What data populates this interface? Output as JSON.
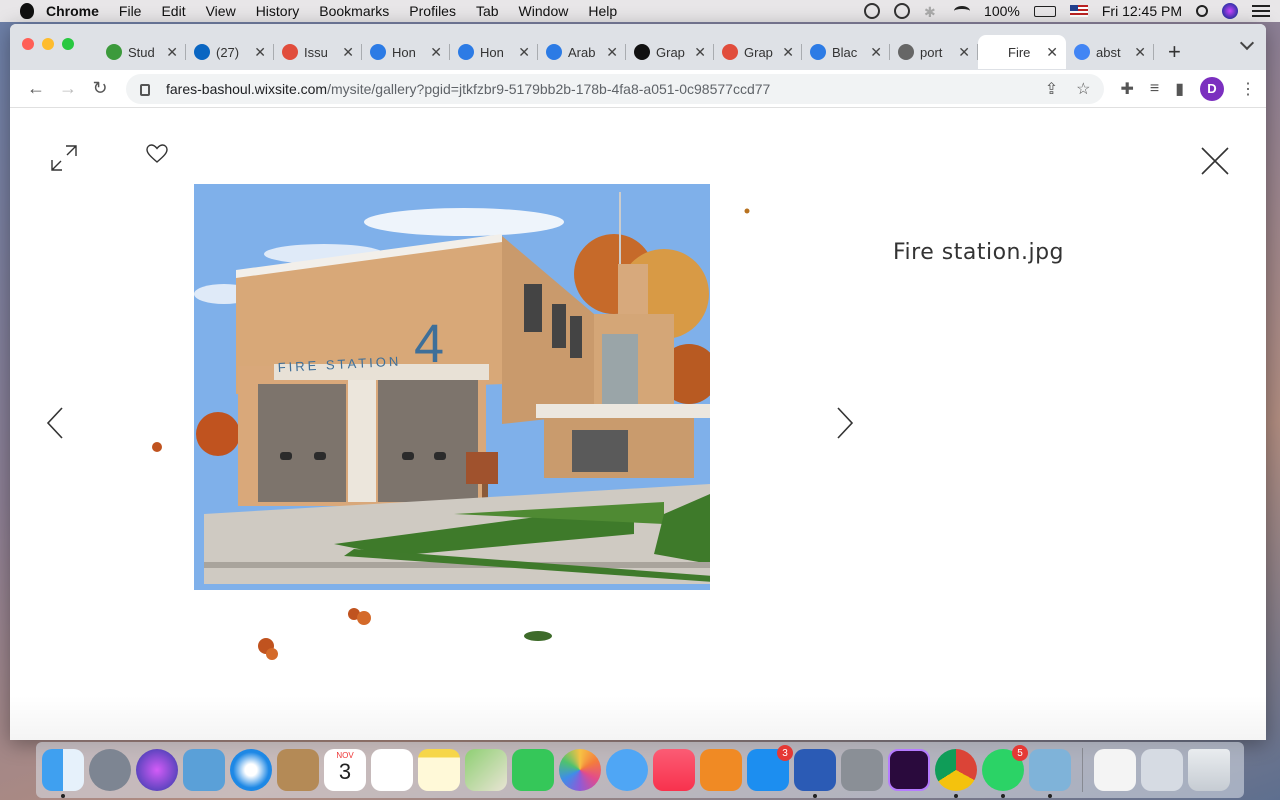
{
  "menubar": {
    "app": "Chrome",
    "items": [
      "File",
      "Edit",
      "View",
      "History",
      "Bookmarks",
      "Profiles",
      "Tab",
      "Window",
      "Help"
    ],
    "battery": "100%",
    "clock": "Fri 12:45 PM"
  },
  "tabs": [
    {
      "label": "Stud",
      "color": "#3c9a3c"
    },
    {
      "label": "(27)",
      "color": "#0a66c2"
    },
    {
      "label": "Issu",
      "color": "#e14d3c"
    },
    {
      "label": "Hon",
      "color": "#2c7be5"
    },
    {
      "label": "Hon",
      "color": "#2c7be5"
    },
    {
      "label": "Arab",
      "color": "#2c7be5"
    },
    {
      "label": "Grap",
      "color": "#111111"
    },
    {
      "label": "Grap",
      "color": "#e14d3c"
    },
    {
      "label": "Blac",
      "color": "#2c7be5"
    },
    {
      "label": "port",
      "color": "#666666"
    },
    {
      "label": "Fire",
      "color": "#ffffff",
      "active": true
    },
    {
      "label": "abst",
      "color": "#4285f4"
    }
  ],
  "address": {
    "host": "fares-bashoul.wixsite.com",
    "path": "/mysite/gallery?pgid=jtkfzbr9-5179bb2b-178b-4fa8-a051-0c98577ccd77"
  },
  "profile_initial": "D",
  "gallery": {
    "image_title": "Fire station.jpg",
    "sign_text": "FIRE STATION",
    "station_number": "4"
  },
  "dock": {
    "calendar_month": "NOV",
    "calendar_day": "3",
    "appstore_badge": "3",
    "whatsapp_badge": "5"
  }
}
